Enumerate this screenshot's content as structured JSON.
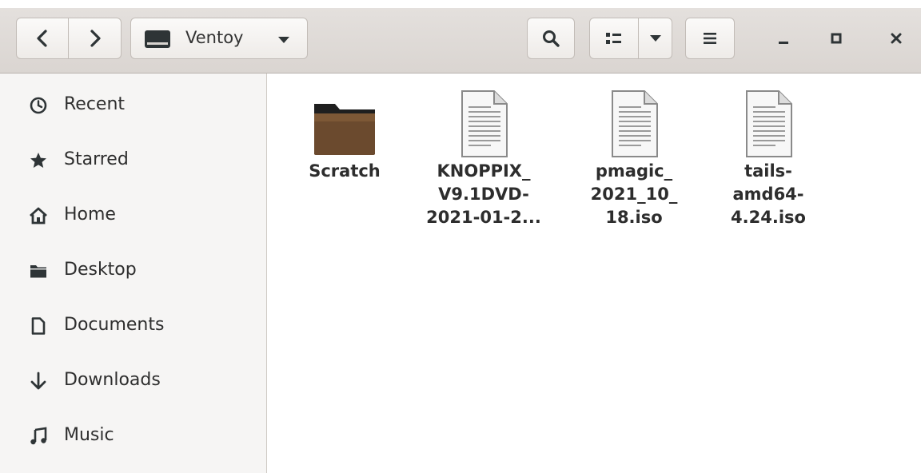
{
  "window": {
    "location": "Ventoy",
    "buttons": {
      "back": "back-arrow",
      "forward": "forward-arrow",
      "search": "search-icon",
      "view_list": "list-view-icon",
      "view_options": "chevron-down-icon",
      "menu": "hamburger-menu-icon",
      "minimize": "minimize-icon",
      "maximize": "maximize-icon",
      "close": "close-icon"
    }
  },
  "sidebar": {
    "items": [
      {
        "label": "Recent",
        "icon": "clock-icon"
      },
      {
        "label": "Starred",
        "icon": "star-icon"
      },
      {
        "label": "Home",
        "icon": "home-icon"
      },
      {
        "label": "Desktop",
        "icon": "folder-icon"
      },
      {
        "label": "Documents",
        "icon": "document-icon"
      },
      {
        "label": "Downloads",
        "icon": "download-arrow-icon"
      },
      {
        "label": "Music",
        "icon": "music-note-icon"
      }
    ]
  },
  "files": [
    {
      "name": "Scratch",
      "type": "folder"
    },
    {
      "name": "KNOPPIX_\nV9.1DVD-\n2021-01-2...",
      "type": "file"
    },
    {
      "name": "pmagic_\n2021_10_\n18.iso",
      "type": "file"
    },
    {
      "name": "tails-\namd64-\n4.24.iso",
      "type": "file"
    }
  ],
  "colors": {
    "headerbar": "#dad5d1",
    "sidebar": "#f6f5f4",
    "folder": "#5a3a22"
  }
}
